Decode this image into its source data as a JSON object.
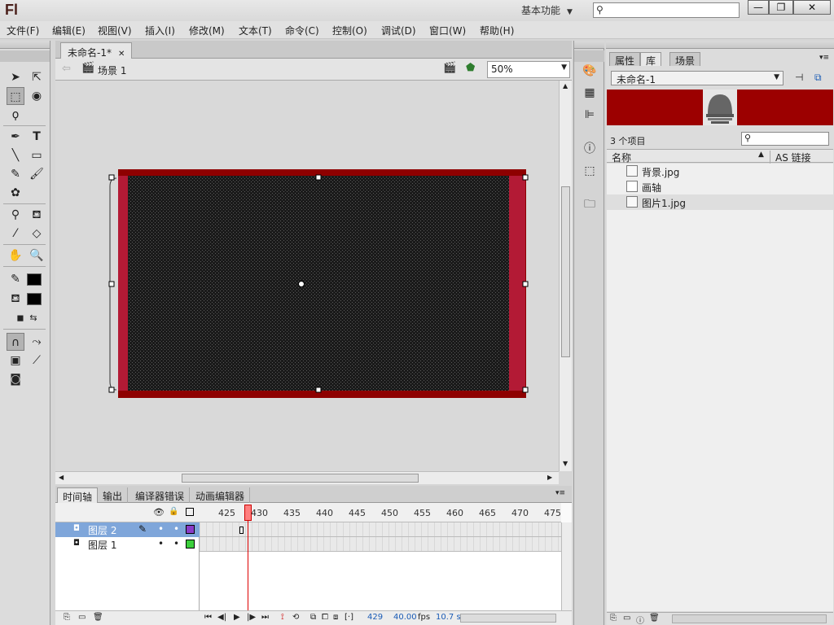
{
  "app": {
    "logo": "Fl",
    "workspace": "基本功能"
  },
  "window_controls": {
    "minimize": "—",
    "maximize": "❐",
    "close": "✕"
  },
  "menu": [
    "文件(F)",
    "编辑(E)",
    "视图(V)",
    "插入(I)",
    "修改(M)",
    "文本(T)",
    "命令(C)",
    "控制(O)",
    "调试(D)",
    "窗口(W)",
    "帮助(H)"
  ],
  "document": {
    "tab_title": "未命名-1*",
    "scene": "场景 1",
    "zoom": "50%"
  },
  "colors": {
    "stage_border": "#8e0000",
    "stage_fill": "#1a1a1a",
    "frame_red": "#b31a35",
    "accent_selected_layer": "#7fa6da"
  },
  "timeline": {
    "tabs": [
      "时间轴",
      "输出",
      "编译器错误",
      "动画编辑器"
    ],
    "ruler": [
      "425",
      "430",
      "435",
      "440",
      "445",
      "450",
      "455",
      "460",
      "465",
      "470",
      "475"
    ],
    "layers": [
      {
        "name": "图层 2",
        "selected": true,
        "color": "#8a3cc8"
      },
      {
        "name": "图层 1",
        "selected": false,
        "color": "#3ccf3c"
      }
    ],
    "status": {
      "frame": "429",
      "fps": "40.00",
      "fps_unit": "fps",
      "time": "10.7 s"
    }
  },
  "library": {
    "tabs": [
      "属性",
      "库",
      "场景"
    ],
    "doc": "未命名-1",
    "count": "3 个项目",
    "col_name": "名称",
    "col_linkage": "AS 链接",
    "items": [
      {
        "name": "背景.jpg",
        "icon": "image-icon"
      },
      {
        "name": "画轴",
        "icon": "movieclip-icon"
      },
      {
        "name": "图片1.jpg",
        "icon": "image-icon"
      }
    ]
  }
}
